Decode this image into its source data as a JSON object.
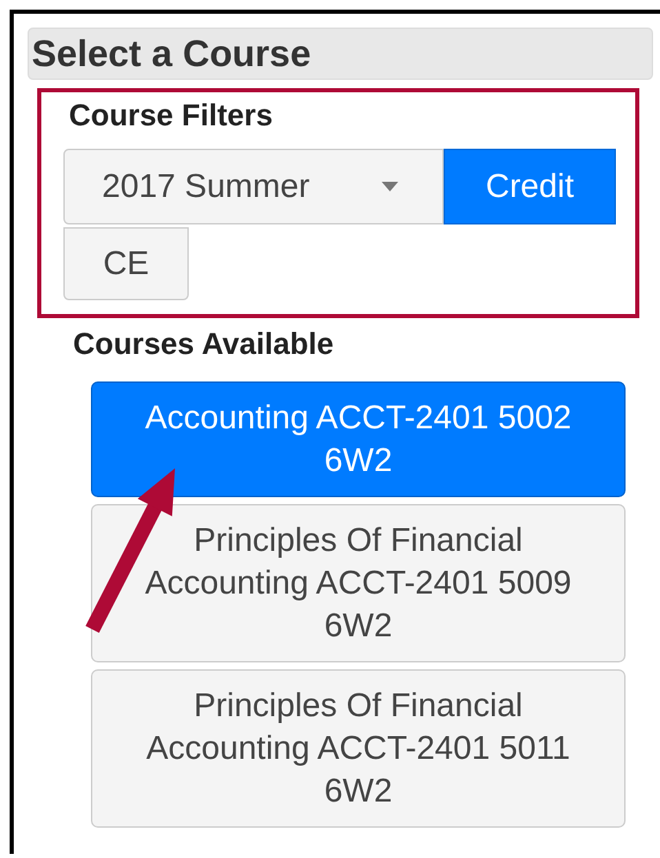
{
  "header": {
    "title": "Select a Course"
  },
  "filters": {
    "label": "Course Filters",
    "term": {
      "value": "2017 Summer"
    },
    "types": [
      {
        "label": "Credit",
        "selected": true
      },
      {
        "label": "CE",
        "selected": false
      }
    ]
  },
  "courses": {
    "label": "Courses Available",
    "items": [
      {
        "title": "Accounting ACCT-2401 5002 6W2",
        "selected": true
      },
      {
        "title": "Principles Of Financial Accounting ACCT-2401 5009 6W2",
        "selected": false
      },
      {
        "title": "Principles Of Financial Accounting ACCT-2401 5011 6W2",
        "selected": false
      }
    ]
  }
}
